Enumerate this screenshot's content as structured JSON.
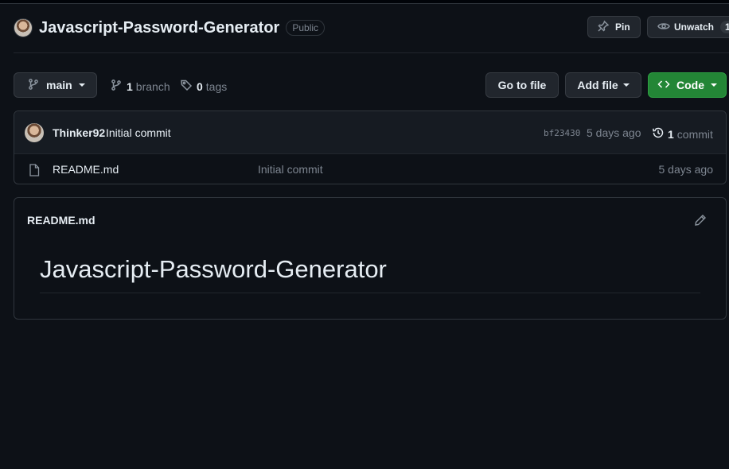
{
  "repo": {
    "name": "Javascript-Password-Generator",
    "visibility": "Public",
    "pin_label": "Pin",
    "unwatch_label": "Unwatch",
    "watch_count": "1"
  },
  "toolbar": {
    "branch_name": "main",
    "branch_count": "1",
    "branch_label": "branch",
    "tag_count": "0",
    "tag_label": "tags",
    "goto_file_label": "Go to file",
    "add_file_label": "Add file",
    "code_label": "Code"
  },
  "latest_commit": {
    "author": "Thinker92",
    "message": "Initial commit",
    "sha": "bf23430",
    "age": "5 days ago",
    "count": "1",
    "count_label": "commit"
  },
  "files": [
    {
      "name": "README.md",
      "message": "Initial commit",
      "age": "5 days ago"
    }
  ],
  "readme": {
    "title": "README.md",
    "heading": "Javascript-Password-Generator"
  },
  "colors": {
    "background": "#0d1117",
    "accent_green": "#238636",
    "border": "#30363d",
    "muted_text": "#7d8590"
  },
  "icons": [
    "avatar",
    "pin-icon",
    "eye-icon",
    "git-branch-icon",
    "tag-icon",
    "code-icon",
    "history-icon",
    "file-icon",
    "pencil-icon"
  ]
}
